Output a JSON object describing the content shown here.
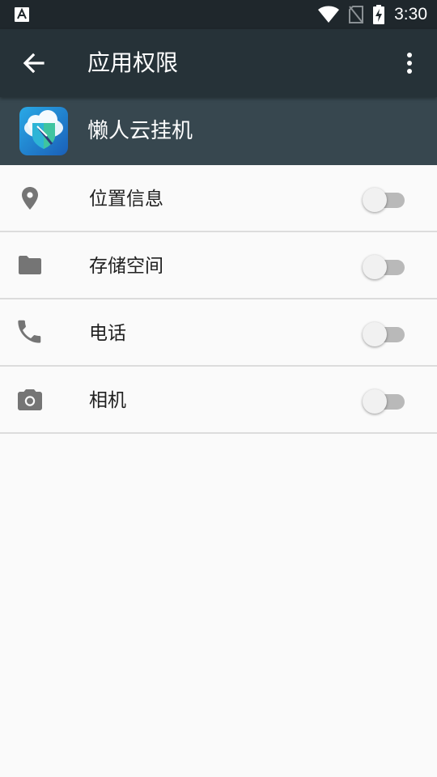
{
  "status_bar": {
    "time": "3:30",
    "icons": [
      "notification-a-icon",
      "wifi-icon",
      "no-sim-icon",
      "battery-charging-icon"
    ]
  },
  "toolbar": {
    "title": "应用权限",
    "back_icon": "arrow-back-icon",
    "overflow_icon": "more-vert-icon"
  },
  "app": {
    "name": "懒人云挂机",
    "icon": "app-cloud-shield-icon"
  },
  "permissions": [
    {
      "label": "位置信息",
      "icon": "location-pin-icon",
      "enabled": false
    },
    {
      "label": "存储空间",
      "icon": "folder-icon",
      "enabled": false
    },
    {
      "label": "电话",
      "icon": "phone-icon",
      "enabled": false
    },
    {
      "label": "相机",
      "icon": "camera-icon",
      "enabled": false
    }
  ],
  "colors": {
    "status_bar": "#1f272c",
    "toolbar": "#263238",
    "app_header": "#37474f",
    "background": "#fafafa",
    "icon_grey": "#757575"
  }
}
